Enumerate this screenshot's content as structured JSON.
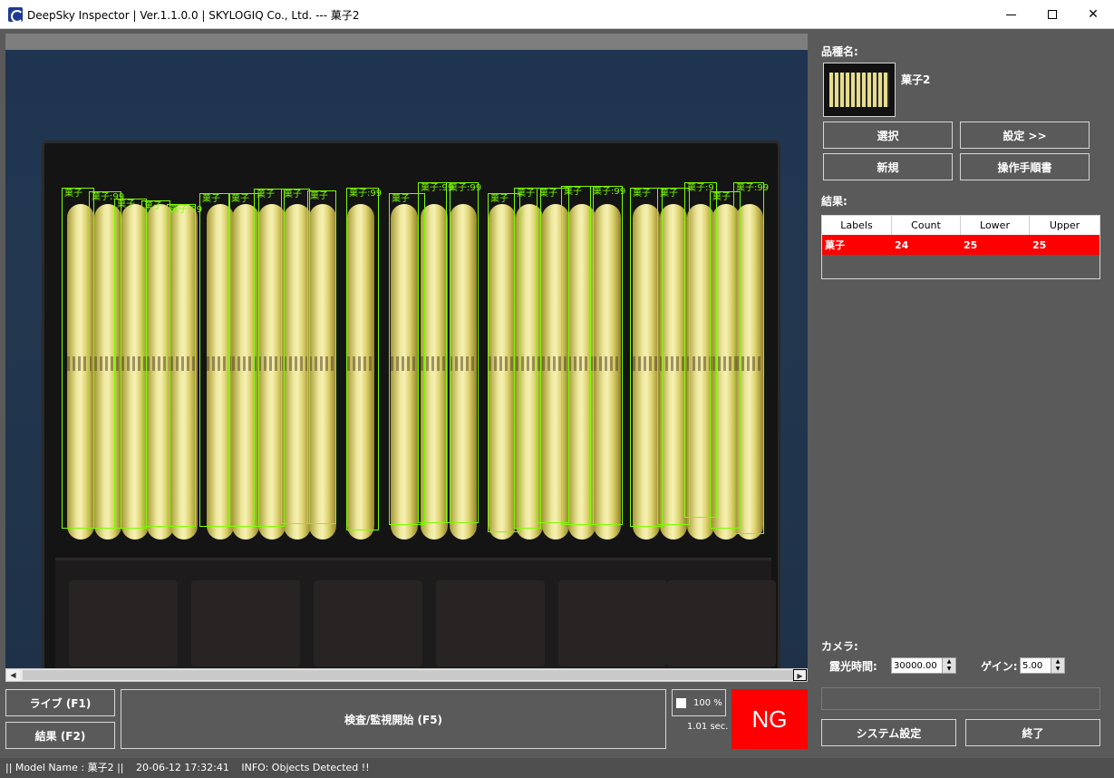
{
  "window": {
    "title": "DeepSky Inspector | Ver.1.1.0.0 | SKYLOGIQ Co., Ltd. --- 菓子2"
  },
  "viewer": {
    "detections": [
      {
        "label": "菓子"
      },
      {
        "label": "菓子:99"
      },
      {
        "label": "菓子"
      },
      {
        "label": "菓子"
      },
      {
        "label": "菓子:99"
      },
      {
        "label": "菓子"
      },
      {
        "label": "菓子"
      },
      {
        "label": "菓子"
      },
      {
        "label": "菓子"
      },
      {
        "label": "菓子"
      },
      {
        "label": "菓子:99"
      },
      {
        "label": "菓子"
      },
      {
        "label": "菓子:99"
      },
      {
        "label": "菓子:99"
      },
      {
        "label": "菓子"
      },
      {
        "label": "菓子"
      },
      {
        "label": "菓子"
      },
      {
        "label": "菓子"
      },
      {
        "label": "菓子:99"
      },
      {
        "label": "菓子"
      },
      {
        "label": "菓子"
      },
      {
        "label": "菓子:9"
      },
      {
        "label": "菓子"
      },
      {
        "label": "菓子:99"
      }
    ]
  },
  "controls": {
    "live_label": "ライブ (F1)",
    "result_label": "結果 (F2)",
    "inspect_label": "検査/監視開始 (F5)",
    "zoom_label": "100 %",
    "elapsed": "1.01 sec.",
    "verdict": "NG",
    "verdict_color": "#ff0000"
  },
  "right_panel": {
    "model_heading": "品種名:",
    "model_name": "菓子2",
    "select_label": "選択",
    "settings_label": "設定 >>",
    "new_label": "新規",
    "manual_label": "操作手順書",
    "results_heading": "結果:",
    "results_table": {
      "headers": [
        "Labels",
        "Count",
        "Lower",
        "Upper"
      ],
      "rows": [
        {
          "label": "菓子",
          "count": "24",
          "lower": "25",
          "upper": "25"
        }
      ]
    },
    "camera_heading": "カメラ:",
    "exposure_label": "露光時間:",
    "exposure_value": "30000.00",
    "gain_label": "ゲイン:",
    "gain_value": "5.00",
    "system_label": "システム設定",
    "exit_label": "終了"
  },
  "statusbar": {
    "model": "|| Model Name : 菓子2 ||",
    "timestamp": "20-06-12 17:32:41",
    "info": "INFO:   Objects Detected !!"
  }
}
